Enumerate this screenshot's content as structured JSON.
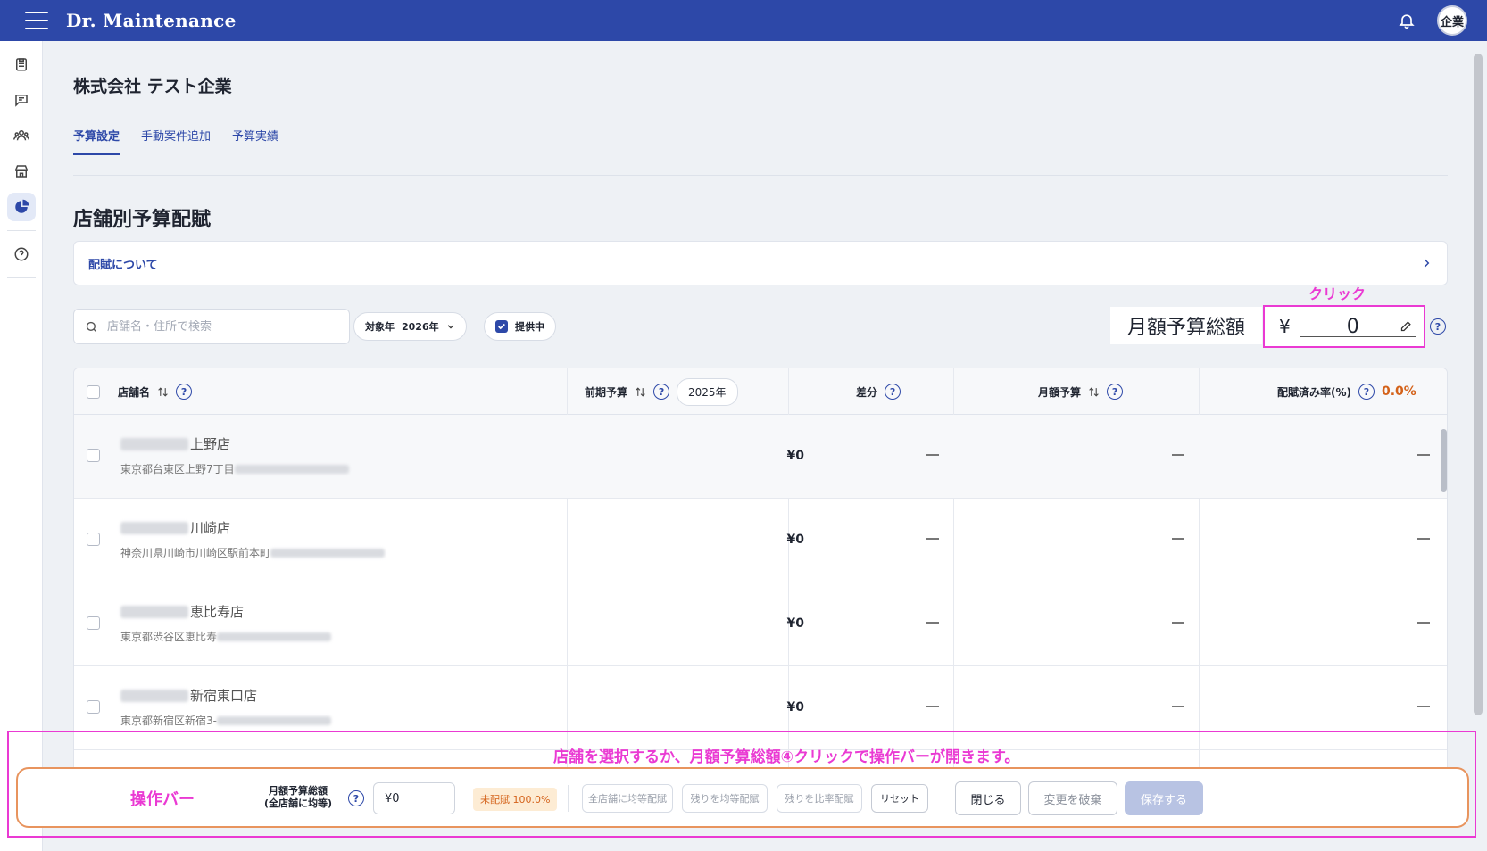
{
  "header": {
    "brand": "Dr. Maintenance",
    "avatar": "企業"
  },
  "company": "株式会社 テスト企業",
  "tabs": [
    {
      "label": "予算設定",
      "active": true
    },
    {
      "label": "手動案件追加",
      "active": false
    },
    {
      "label": "予算実績",
      "active": false
    }
  ],
  "section_title": "店舗別予算配賦",
  "about_link": "配賦について",
  "search": {
    "placeholder": "店舗名・住所で検索"
  },
  "filters": {
    "year_label": "対象年",
    "year_value": "2026年",
    "active_label": "提供中",
    "active_checked": true
  },
  "budget": {
    "label": "月額予算総額",
    "currency": "¥",
    "value": "0",
    "annotation": "クリック"
  },
  "table": {
    "headers": {
      "store": "店舗名",
      "prev_budget": "前期予算",
      "prev_year": "2025年",
      "diff": "差分",
      "monthly": "月額予算",
      "rate": "配賦済み率(%)",
      "rate_value": "0.0%"
    },
    "rows": [
      {
        "name": "上野店",
        "address": "東京都台東区上野7丁目",
        "prev": "¥0",
        "diff": "—",
        "monthly": "—",
        "rate": "—"
      },
      {
        "name": "川崎店",
        "address": "神奈川県川崎市川崎区駅前本町",
        "prev": "¥0",
        "diff": "—",
        "monthly": "—",
        "rate": "—"
      },
      {
        "name": "恵比寿店",
        "address": "東京都渋谷区恵比寿",
        "prev": "¥0",
        "diff": "—",
        "monthly": "—",
        "rate": "—"
      },
      {
        "name": "新宿東口店",
        "address": "東京都新宿区新宿3-",
        "prev": "¥0",
        "diff": "—",
        "monthly": "—",
        "rate": "—"
      }
    ]
  },
  "annotation_note": "店舗を選択するか、月額予算総額④クリックで操作バーが開きます。",
  "opbar": {
    "label": "操作バー",
    "sub_line1": "月額予算総額",
    "sub_line2": "(全店舗に均等)",
    "input_value": "¥0",
    "unallocated": "未配賦 100.0%",
    "btn_equal_all": "全店舗に均等配賦",
    "btn_remaining_equal": "残りを均等配賦",
    "btn_remaining_ratio": "残りを比率配賦",
    "btn_reset": "リセット",
    "btn_close": "閉じる",
    "btn_discard": "変更を破棄",
    "btn_save": "保存する"
  },
  "colors": {
    "brand": "#2d48a8",
    "annotation": "#ea3ad3",
    "warning": "#d4621a"
  }
}
